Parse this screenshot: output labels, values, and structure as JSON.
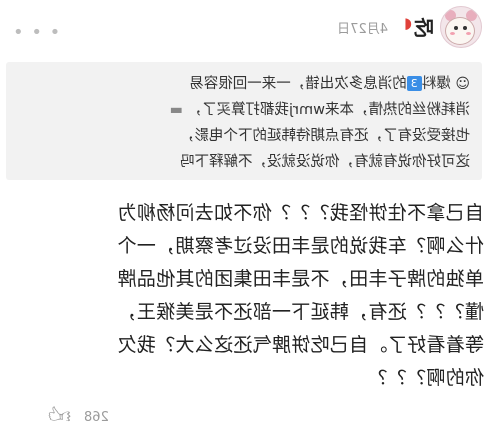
{
  "header": {
    "username": "吃",
    "melon_icon": "watermelon-icon",
    "time": "4月27日",
    "more_icon": "ellipsis-icon"
  },
  "quote": {
    "lines": [
      "爆料 的消息多次出错，一来一回很容易",
      "消耗粉丝的热情，本来wmrj我都打算买了，",
      "也接受没有了，还有点期待韩延的下个电影，",
      "这可好你说有就有，你说没就没，不解释下吗"
    ],
    "tag": "3"
  },
  "body": {
    "lines": [
      "自己拿不住饼怪我？？？你不如去问杨柳为",
      "什么啊？车我说的是丰田没过考察期，一个",
      "单独的牌子丰田，不是丰田集团的其他品牌",
      "懂？？？还有，韩延下一部还不是美猴王，",
      "等着看好了。自己吃饼脾气还这么大？我欠",
      "你的啊？？？"
    ]
  },
  "footer": {
    "like_count": "268",
    "like_icon": "thumbs-up-icon"
  }
}
